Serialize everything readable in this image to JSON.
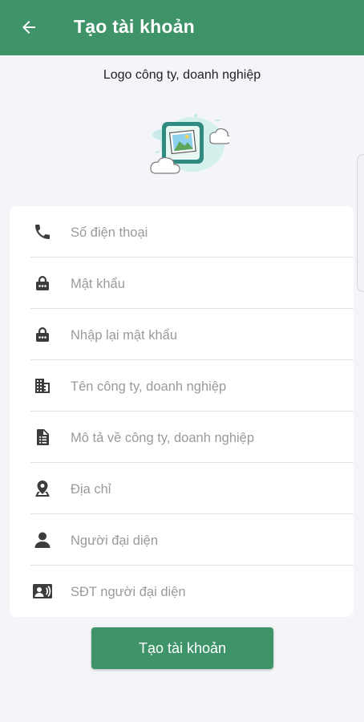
{
  "appbar": {
    "title": "Tạo tài khoản",
    "back_icon": "arrow-left-icon"
  },
  "logo": {
    "caption": "Logo công ty, doanh nghiệp",
    "icon": "image-placeholder-icon"
  },
  "form": {
    "fields": [
      {
        "placeholder": "Số điện thoại",
        "value": "",
        "icon": "phone-icon"
      },
      {
        "placeholder": "Mật khẩu",
        "value": "",
        "icon": "lock-icon"
      },
      {
        "placeholder": "Nhập lại mật khẩu",
        "value": "",
        "icon": "lock-icon"
      },
      {
        "placeholder": "Tên công ty, doanh nghiệp",
        "value": "",
        "icon": "building-icon"
      },
      {
        "placeholder": "Mô tả về công ty, doanh nghiệp",
        "value": "",
        "icon": "document-icon"
      },
      {
        "placeholder": "Địa chỉ",
        "value": "",
        "icon": "location-pin-icon"
      },
      {
        "placeholder": "Người đại diện",
        "value": "",
        "icon": "person-icon"
      },
      {
        "placeholder": "SĐT người đại diện",
        "value": "",
        "icon": "contact-card-icon"
      }
    ]
  },
  "submit": {
    "label": "Tạo tài khoản"
  },
  "colors": {
    "primary": "#3f9368",
    "background": "#f4f5f9",
    "icon": "#3c3c3c",
    "placeholder": "#9a9a9a"
  }
}
